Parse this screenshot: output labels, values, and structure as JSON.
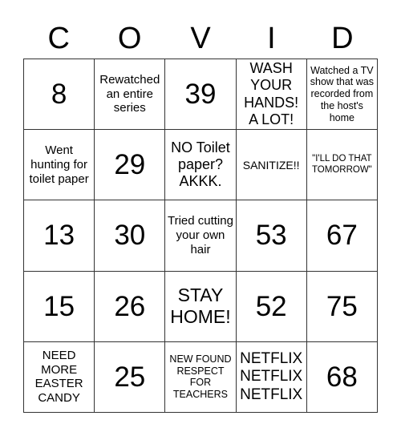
{
  "header": [
    "C",
    "O",
    "V",
    "I",
    "D"
  ],
  "cells": [
    [
      "8",
      "Rewatched an entire series",
      "39",
      "WASH YOUR HANDS! A LOT!",
      "Watched a TV show that was recorded from the host's home"
    ],
    [
      "Went hunting for toilet paper",
      "29",
      "NO Toilet paper? AKKK.",
      "SANITIZE!!",
      "\"I'LL DO THAT TOMORROW\""
    ],
    [
      "13",
      "30",
      "Tried cutting your own hair",
      "53",
      "67"
    ],
    [
      "15",
      "26",
      "STAY HOME!",
      "52",
      "75"
    ],
    [
      "NEED MORE EASTER CANDY",
      "25",
      "NEW FOUND RESPECT FOR TEACHERS",
      "NETFLIX NETFLIX NETFLIX",
      "68"
    ]
  ]
}
